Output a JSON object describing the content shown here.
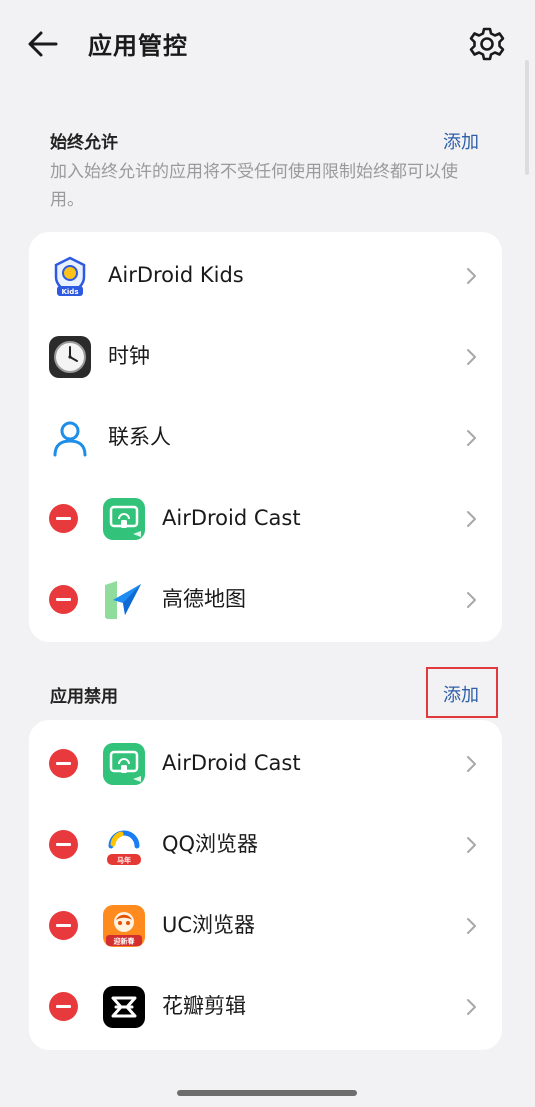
{
  "header": {
    "title": "应用管控"
  },
  "always_allow": {
    "title": "始终允许",
    "add_label": "添加",
    "description": "加入始终允许的应用将不受任何使用限制始终都可以使用。",
    "items": [
      {
        "label": "AirDroid Kids",
        "icon": "airdroid-kids-icon",
        "icon_badge": "Kids",
        "removable": false
      },
      {
        "label": "时钟",
        "icon": "clock-icon",
        "removable": false
      },
      {
        "label": "联系人",
        "icon": "contacts-icon",
        "removable": false
      },
      {
        "label": "AirDroid Cast",
        "icon": "airdroid-cast-icon",
        "removable": true
      },
      {
        "label": "高德地图",
        "icon": "amap-icon",
        "removable": true
      }
    ]
  },
  "blocked": {
    "title": "应用禁用",
    "add_label": "添加",
    "items": [
      {
        "label": "AirDroid Cast",
        "icon": "airdroid-cast-icon",
        "removable": true
      },
      {
        "label": "QQ浏览器",
        "icon": "qq-browser-icon",
        "icon_badge": "马年",
        "removable": true
      },
      {
        "label": "UC浏览器",
        "icon": "uc-browser-icon",
        "icon_badge": "迎新春",
        "removable": true
      },
      {
        "label": "花瓣剪辑",
        "icon": "petal-clip-icon",
        "removable": true
      }
    ]
  },
  "colors": {
    "accent": "#2f5fa8",
    "remove": "#e8393d",
    "highlight": "#e0393e",
    "background": "#f2f2f4"
  }
}
